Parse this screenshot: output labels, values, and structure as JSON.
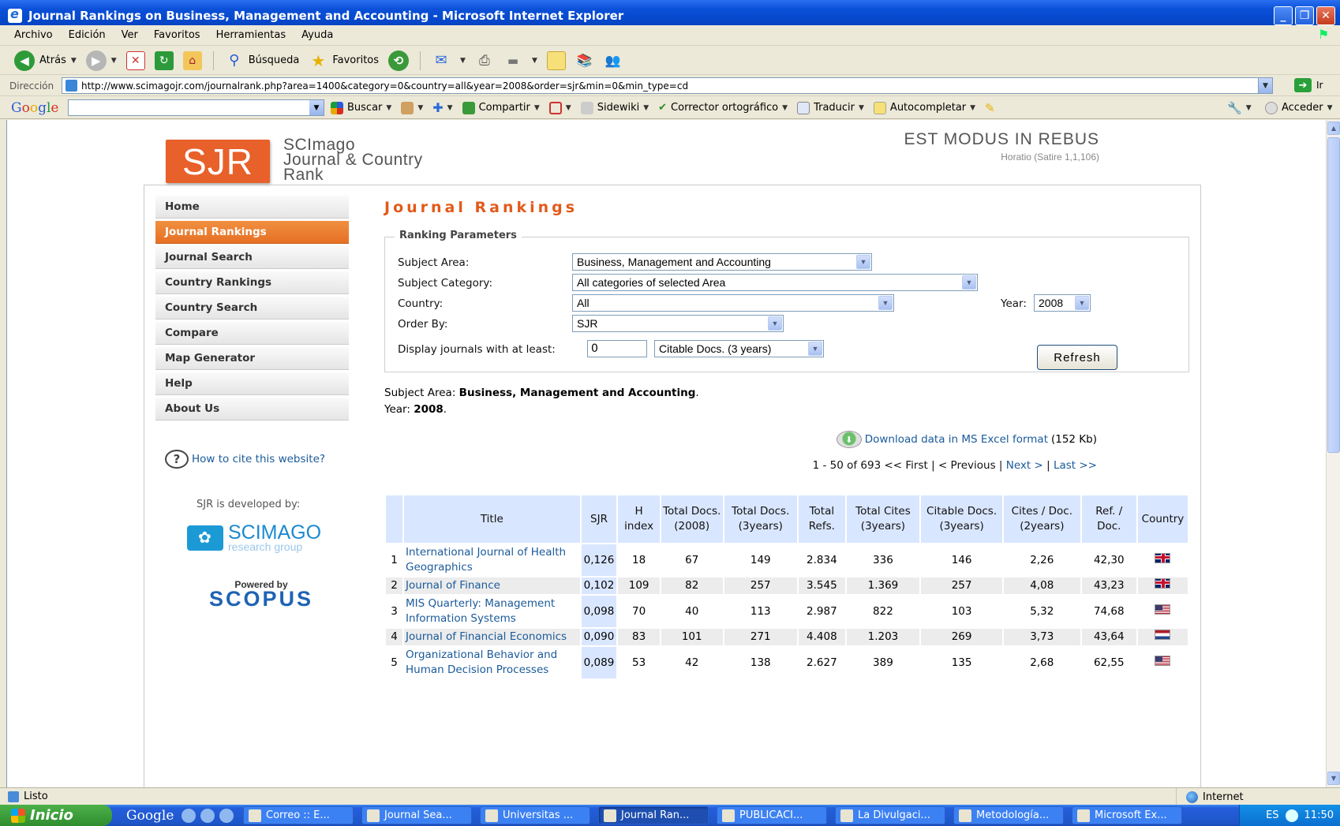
{
  "window": {
    "title": "Journal Rankings on Business, Management and Accounting - Microsoft Internet Explorer"
  },
  "menu": [
    "Archivo",
    "Edición",
    "Ver",
    "Favoritos",
    "Herramientas",
    "Ayuda"
  ],
  "toolbar": {
    "back": "Atrás",
    "search": "Búsqueda",
    "favorites": "Favoritos"
  },
  "address": {
    "label": "Dirección",
    "url": "http://www.scimagojr.com/journalrank.php?area=1400&category=0&country=all&year=2008&order=sjr&min=0&min_type=cd",
    "go": "Ir"
  },
  "googlebar": {
    "logo": [
      "G",
      "o",
      "o",
      "g",
      "l",
      "e"
    ],
    "buscar": "Buscar",
    "compartir": "Compartir",
    "sidewiki": "Sidewiki",
    "corrector": "Corrector ortográfico",
    "traducir": "Traducir",
    "autocompletar": "Autocompletar",
    "acceder": "Acceder"
  },
  "site": {
    "logo": "SJR",
    "name": [
      "SCImago",
      "Journal & Country",
      "Rank"
    ],
    "motto": "EST MODUS IN REBUS",
    "motto_source": "Horatio (Satire 1,1,106)"
  },
  "nav": [
    {
      "label": "Home",
      "active": false
    },
    {
      "label": "Journal Rankings",
      "active": true
    },
    {
      "label": "Journal Search",
      "active": false
    },
    {
      "label": "Country Rankings",
      "active": false
    },
    {
      "label": "Country Search",
      "active": false
    },
    {
      "label": "Compare",
      "active": false
    },
    {
      "label": "Map Generator",
      "active": false
    },
    {
      "label": "Help",
      "active": false
    },
    {
      "label": "About Us",
      "active": false
    }
  ],
  "sidebar": {
    "cite_link": "How to cite this website?",
    "developed_by": "SJR is developed by:",
    "scimago": "SCIMAGO",
    "scimago_sub": "research group",
    "powered_by": "Powered by",
    "scopus": "SCOPUS"
  },
  "main": {
    "heading": "Journal Rankings",
    "params_legend": "Ranking Parameters",
    "subject_area_label": "Subject Area:",
    "subject_area_value": "Business, Management and Accounting",
    "subject_category_label": "Subject Category:",
    "subject_category_value": "All categories of selected Area",
    "country_label": "Country:",
    "country_value": "All",
    "year_label": "Year:",
    "year_value": "2008",
    "order_label": "Order By:",
    "order_value": "SJR",
    "display_label": "Display journals with at least:",
    "min_value": "0",
    "min_type_value": "Citable Docs. (3 years)",
    "refresh": "Refresh",
    "summary_area_label": "Subject Area:",
    "summary_area_value": "Business, Management and Accounting",
    "summary_year_label": "Year:",
    "summary_year_value": "2008",
    "download_link": "Download data in MS Excel format",
    "download_size": "(152 Kb)",
    "paging_range": "1 - 50 of 693",
    "paging_first": "<< First",
    "paging_prev": "< Previous",
    "paging_next": "Next >",
    "paging_last": "Last >>"
  },
  "table": {
    "headers": [
      "",
      "Title",
      "SJR",
      "H index",
      "Total Docs. (2008)",
      "Total Docs. (3years)",
      "Total Refs.",
      "Total Cites (3years)",
      "Citable Docs. (3years)",
      "Cites / Doc. (2years)",
      "Ref. / Doc.",
      "Country"
    ],
    "rows": [
      {
        "rank": "1",
        "title": "International Journal of Health Geographics",
        "sjr": "0,126",
        "h": "18",
        "docs2008": "67",
        "docs3y": "149",
        "refs": "2.834",
        "cites3y": "336",
        "citable3y": "146",
        "citesdoc": "2,26",
        "refdoc": "42,30",
        "country": "gb"
      },
      {
        "rank": "2",
        "title": "Journal of Finance",
        "sjr": "0,102",
        "h": "109",
        "docs2008": "82",
        "docs3y": "257",
        "refs": "3.545",
        "cites3y": "1.369",
        "citable3y": "257",
        "citesdoc": "4,08",
        "refdoc": "43,23",
        "country": "gb"
      },
      {
        "rank": "3",
        "title": "MIS Quarterly: Management Information Systems",
        "sjr": "0,098",
        "h": "70",
        "docs2008": "40",
        "docs3y": "113",
        "refs": "2.987",
        "cites3y": "822",
        "citable3y": "103",
        "citesdoc": "5,32",
        "refdoc": "74,68",
        "country": "us"
      },
      {
        "rank": "4",
        "title": "Journal of Financial Economics",
        "sjr": "0,090",
        "h": "83",
        "docs2008": "101",
        "docs3y": "271",
        "refs": "4.408",
        "cites3y": "1.203",
        "citable3y": "269",
        "citesdoc": "3,73",
        "refdoc": "43,64",
        "country": "nl"
      },
      {
        "rank": "5",
        "title": "Organizational Behavior and Human Decision Processes",
        "sjr": "0,089",
        "h": "53",
        "docs2008": "42",
        "docs3y": "138",
        "refs": "2.627",
        "cites3y": "389",
        "citable3y": "135",
        "citesdoc": "2,68",
        "refdoc": "62,55",
        "country": "us"
      }
    ]
  },
  "status": {
    "text": "Listo",
    "zone": "Internet"
  },
  "taskbar": {
    "start": "Inicio",
    "google": "Google",
    "tasks": [
      {
        "label": "Correo :: E...",
        "active": false
      },
      {
        "label": "Journal Sea...",
        "active": false
      },
      {
        "label": "Universitas ...",
        "active": false
      },
      {
        "label": "Journal Ran...",
        "active": true
      },
      {
        "label": "PUBLICACI...",
        "active": false
      },
      {
        "label": "La Divulgaci...",
        "active": false
      },
      {
        "label": "Metodología...",
        "active": false
      },
      {
        "label": "Microsoft Ex...",
        "active": false
      }
    ],
    "lang": "ES",
    "clock": "11:50"
  }
}
